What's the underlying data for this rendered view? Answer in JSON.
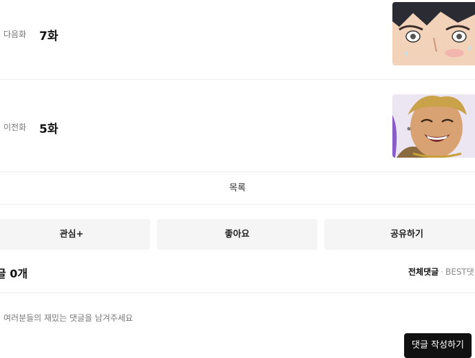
{
  "next_episode": {
    "kind_label": "다음화",
    "title": "7화"
  },
  "prev_episode": {
    "kind_label": "이전화",
    "title": "5화"
  },
  "list_button": "목록",
  "actions": {
    "interest": "관심+",
    "like": "좋아요",
    "share": "공유하기"
  },
  "comments": {
    "count_label": "글 0개",
    "sort_all": "전체댓글",
    "sort_best": "BEST댓",
    "input_placeholder": "여러분들의 재밌는 댓글을 남겨주세요",
    "write_button": "댓글 작성하기"
  }
}
